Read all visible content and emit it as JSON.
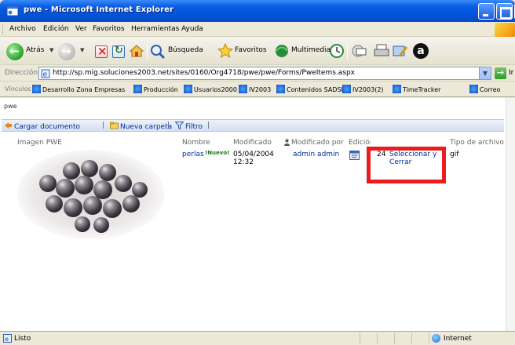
{
  "window": {
    "title": "pwe - Microsoft Internet Explorer"
  },
  "menu": [
    "Archivo",
    "Edición",
    "Ver",
    "Favoritos",
    "Herramientas",
    "Ayuda"
  ],
  "toolbar": {
    "back_label": "Atrás",
    "search_label": "Búsqueda",
    "favorites_label": "Favoritos",
    "media_label": "Multimedia"
  },
  "address": {
    "label": "Dirección",
    "url": "http://sp.mig.soluciones2003.net/sites/0160/Org4718/pwe/pwe/Forms/PweItems.aspx",
    "go_label": "Ir"
  },
  "links": {
    "label": "Vínculos",
    "items": [
      "Desarrollo Zona Empresas",
      "Producción",
      "Usuarios2000",
      "IV2003",
      "Contenidos SADSL",
      "IV2003(2)",
      "TimeTracker",
      "Correo"
    ]
  },
  "page": {
    "breadcrumb": "pwe",
    "actions": {
      "upload": "Cargar documento",
      "new_folder": "Nueva carpeta",
      "filter": "Filtro"
    },
    "columns": {
      "image": "Imagen PWE",
      "name": "Nombre",
      "modified": "Modificado",
      "modified_by": "Modificado por",
      "edit": "Edición",
      "type": "Tipo de archivo"
    },
    "row": {
      "name": "perlas",
      "new_badge": "Nuevo",
      "date": "05/04/2004",
      "time": "12:32",
      "modified_by": "admin admin",
      "size": "24",
      "select_line1": "Seleccionar y",
      "select_line2": "Cerrar",
      "type": "gif"
    }
  },
  "status": {
    "left": "Listo",
    "zone": "Internet"
  },
  "colors": {
    "title_bar": "#0a5ce3",
    "link": "#00319c",
    "highlight_box": "#ec1c1c"
  }
}
